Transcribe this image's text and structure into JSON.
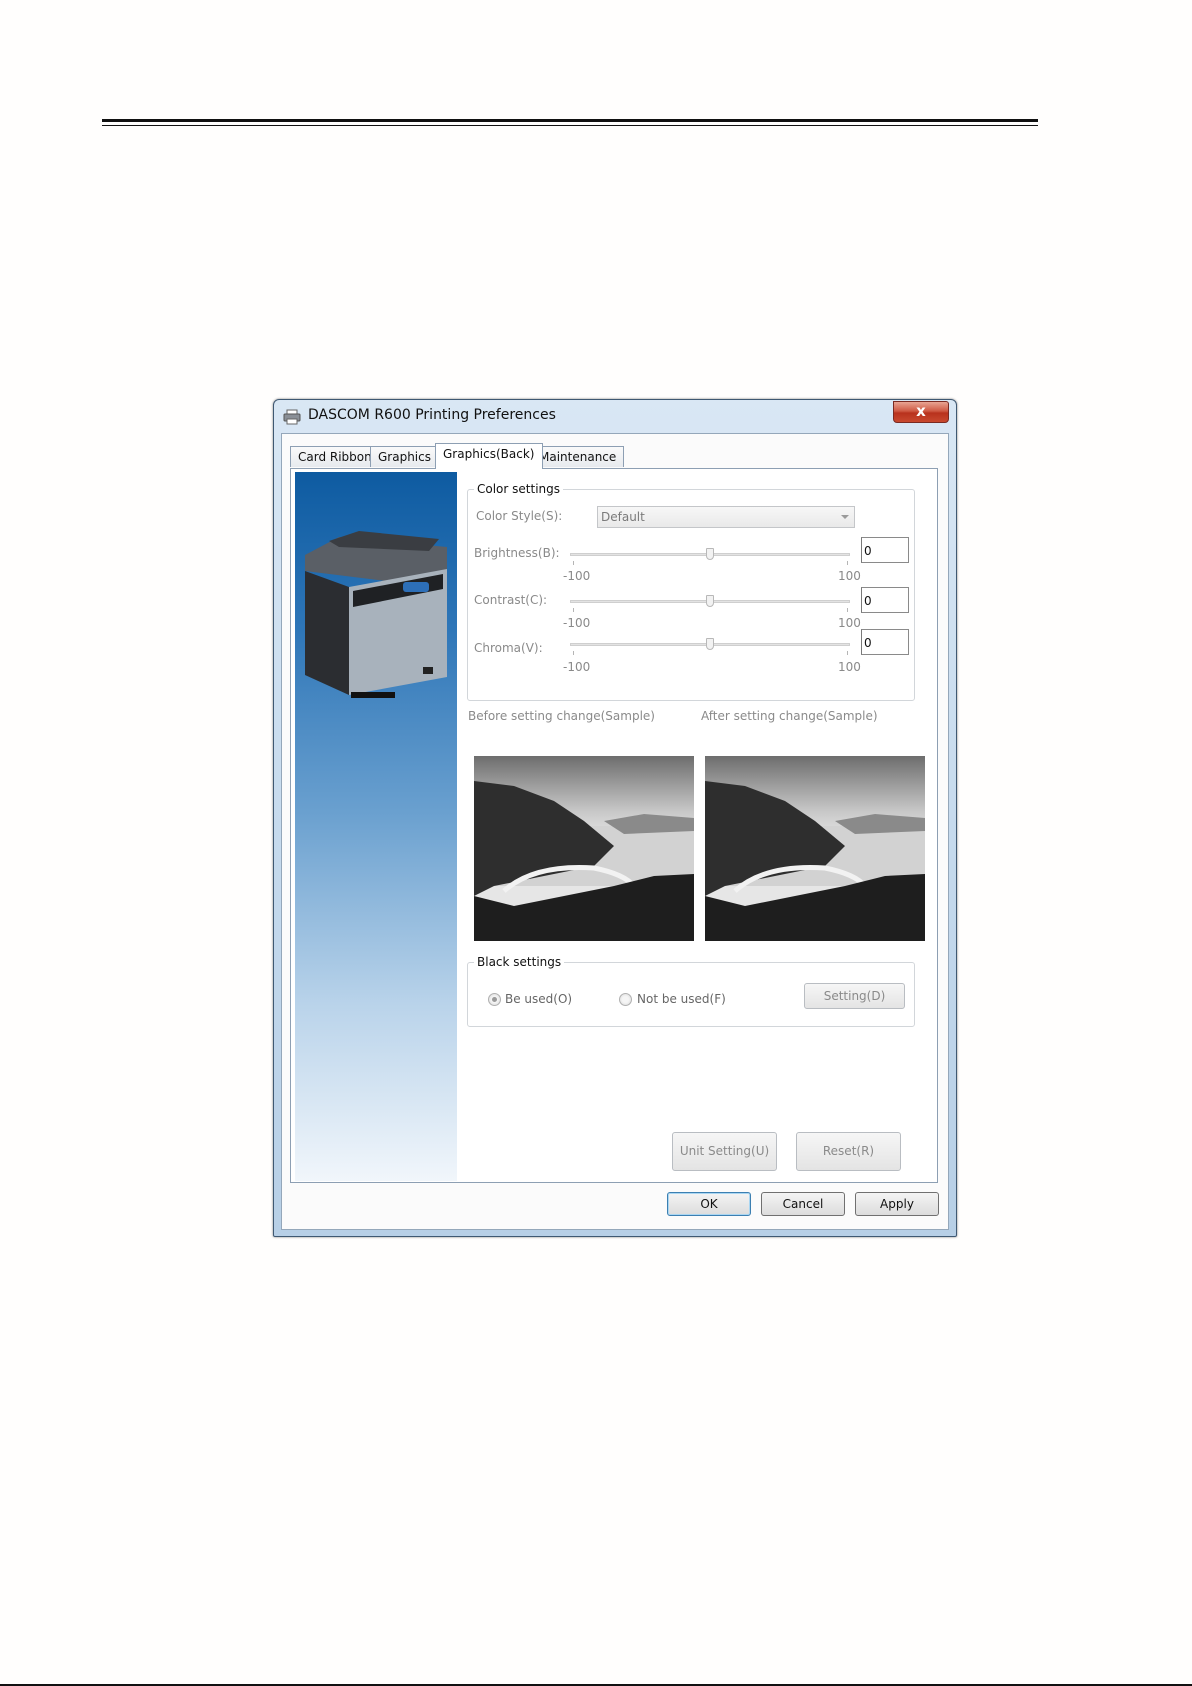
{
  "window": {
    "title": "DASCOM R600 Printing Preferences",
    "close_label": "x"
  },
  "tabs": [
    {
      "label": "Card  Ribbon",
      "active": false
    },
    {
      "label": "Graphics",
      "active": false
    },
    {
      "label": "Graphics(Back)",
      "active": true
    },
    {
      "label": "Maintenance",
      "active": false
    }
  ],
  "color_settings": {
    "group_label": "Color settings",
    "color_style_label": "Color Style(S):",
    "color_style_value": "Default",
    "sliders": [
      {
        "label": "Brightness(B):",
        "min_label": "-100",
        "max_label": "100",
        "value": "0",
        "level": 0
      },
      {
        "label": "Contrast(C):",
        "min_label": "-100",
        "max_label": "100",
        "value": "0",
        "level": 0
      },
      {
        "label": "Chroma(V):",
        "min_label": "-100",
        "max_label": "100",
        "value": "0",
        "level": 0
      }
    ]
  },
  "samples": {
    "before_label": "Before setting change(Sample)",
    "after_label": "After setting change(Sample)"
  },
  "black_settings": {
    "group_label": "Black settings",
    "option_used": "Be used(O)",
    "option_not_used": "Not be used(F)",
    "selected": "used",
    "setting_button": "Setting(D)"
  },
  "panel_buttons": {
    "unit_setting": "Unit Setting(U)",
    "reset": "Reset(R)"
  },
  "dialog_buttons": {
    "ok": "OK",
    "cancel": "Cancel",
    "apply": "Apply"
  }
}
